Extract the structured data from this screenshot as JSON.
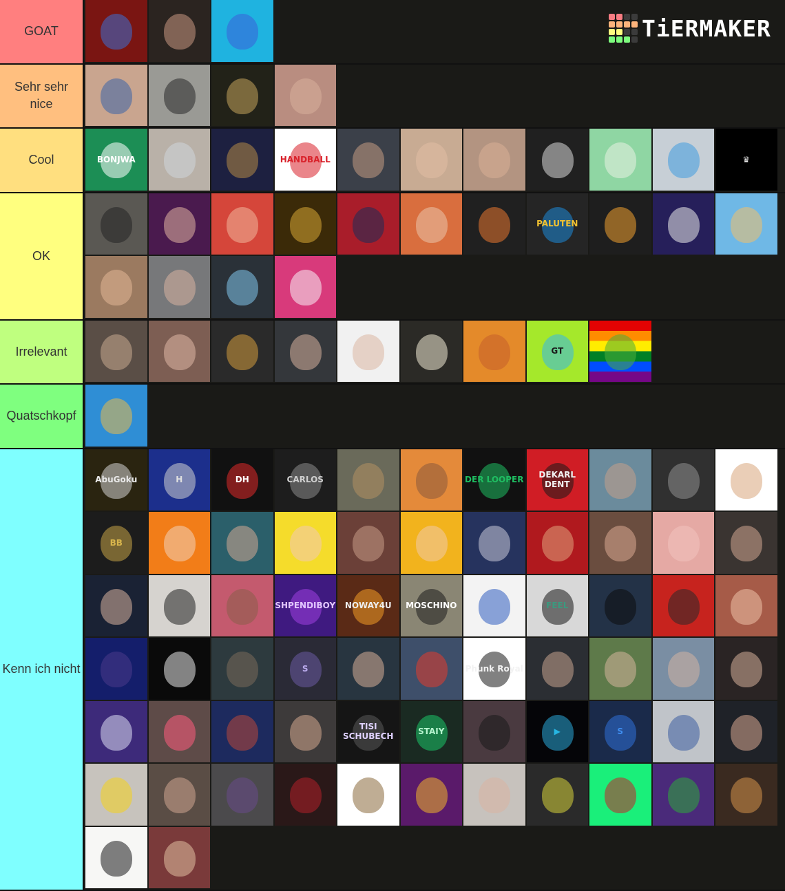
{
  "logo": {
    "text": "TiERMAKER",
    "grid_colors": [
      "#f87c82",
      "#f87c82",
      "#3b3b3b",
      "#3b3b3b",
      "#fcb37b",
      "#fcb37b",
      "#fcb37b",
      "#fcb37b",
      "#ffff7f",
      "#ffff7f",
      "#3b3b3b",
      "#3b3b3b",
      "#7dfd7e",
      "#7dfd7e",
      "#7dfd7e",
      "#3b3b3b"
    ]
  },
  "tiers": [
    {
      "label": "GOAT",
      "color": "#ff7f7f",
      "items": [
        {
          "name": "minecraft-red-skin-avatar",
          "color": "#7a1512",
          "face": "#3b6fd3",
          "text": ""
        },
        {
          "name": "woman-glasses-avatar",
          "color": "#2b2420",
          "face": "#c99882",
          "text": ""
        },
        {
          "name": "blue-dinosaur-logo",
          "color": "#1fb3e0",
          "face": "#3a5fd8",
          "text": ""
        }
      ]
    },
    {
      "label": "Sehr sehr nice",
      "color": "#ffbf7f",
      "items": [
        {
          "name": "man-blue-sunglasses-avatar",
          "color": "#c9a58f",
          "face": "#3a64a8",
          "text": ""
        },
        {
          "name": "vr-headset-avatar",
          "color": "#9a9a95",
          "face": "#2a2a2a",
          "text": ""
        },
        {
          "name": "cartoon-screaming-face-avatar",
          "color": "#222218",
          "face": "#c4a45c",
          "text": ""
        },
        {
          "name": "smiling-woman-avatar",
          "color": "#b98d80",
          "face": "#d8b09b",
          "text": ""
        }
      ]
    },
    {
      "label": "Cool",
      "color": "#ffdf7f",
      "items": [
        {
          "name": "bonjwa-logo",
          "color": "#1c8e55",
          "face": "#ffffff",
          "text": "BONJWA",
          "tcolor": "#ffffff"
        },
        {
          "name": "goggles-man-avatar",
          "color": "#b9b1a8",
          "face": "#cfd5da",
          "text": ""
        },
        {
          "name": "lion-avatar",
          "color": "#1d2040",
          "face": "#b58a46",
          "text": ""
        },
        {
          "name": "handball-logo",
          "color": "#ffffff",
          "face": "#d9212a",
          "text": "HANDBALL",
          "tcolor": "#d9212a"
        },
        {
          "name": "man-cap-avatar",
          "color": "#3b4049",
          "face": "#c59a82",
          "text": ""
        },
        {
          "name": "blonde-woman-avatar",
          "color": "#c8ab93",
          "face": "#e2bea4",
          "text": ""
        },
        {
          "name": "closeup-smile-avatar",
          "color": "#b39481",
          "face": "#d8ae95",
          "text": ""
        },
        {
          "name": "man-sunglasses-logo",
          "color": "#202020",
          "face": "#d8d8d8",
          "text": ""
        },
        {
          "name": "green-cat-cartoon",
          "color": "#8fd6a3",
          "face": "#eaf3e4",
          "text": ""
        },
        {
          "name": "blue-hair-man-avatar",
          "color": "#c7cfd6",
          "face": "#3f9de0",
          "text": ""
        },
        {
          "name": "crown-monogram-logo",
          "color": "#000000",
          "face": "#000000",
          "text": "♛",
          "tcolor": "#e8e8e8"
        }
      ]
    },
    {
      "label": "OK",
      "color": "#ffff7f",
      "items": [
        {
          "name": "bearded-man-hoodie-avatar",
          "color": "#5a5853",
          "face": "#242424",
          "text": ""
        },
        {
          "name": "woman-headset-avatar",
          "color": "#4a1a4e",
          "face": "#e0b5a0",
          "text": ""
        },
        {
          "name": "surprised-man-red-avatar",
          "color": "#d5463a",
          "face": "#f0b79a",
          "text": ""
        },
        {
          "name": "man-crown-gold-avatar",
          "color": "#3b2a08",
          "face": "#d7a634",
          "text": ""
        },
        {
          "name": "man-suit-red-avatar",
          "color": "#a91d2a",
          "face": "#1b2c57",
          "text": ""
        },
        {
          "name": "young-man-orange-avatar",
          "color": "#d96e3e",
          "face": "#e9c5aa",
          "text": ""
        },
        {
          "name": "orange-hexagon-logo",
          "color": "#202020",
          "face": "#e7772f",
          "text": ""
        },
        {
          "name": "team-paluten-logo",
          "color": "#252525",
          "face": "#1d8bd9",
          "text": "PALUTEN",
          "tcolor": "#f2c230"
        },
        {
          "name": "orange-fox-logo",
          "color": "#1e1e1e",
          "face": "#f0a02f",
          "text": ""
        },
        {
          "name": "astronaut-earth-logo",
          "color": "#261f5a",
          "face": "#e9e9e9",
          "text": ""
        },
        {
          "name": "minecraft-blonde-boy-avatar",
          "color": "#6fb8e6",
          "face": "#f0c069",
          "text": ""
        },
        {
          "name": "blonde-woman-selfie-avatar",
          "color": "#9b7a60",
          "face": "#e2b696",
          "text": ""
        },
        {
          "name": "man-earphones-avatar",
          "color": "#77787a",
          "face": "#d9b3a0",
          "text": ""
        },
        {
          "name": "blue-ball-cartoon",
          "color": "#2a3138",
          "face": "#7fc4eb",
          "text": ""
        },
        {
          "name": "white-cat-hat-cartoon",
          "color": "#d83a7b",
          "face": "#f8f1f5",
          "text": ""
        }
      ]
    },
    {
      "label": "Irrelevant",
      "color": "#bfff7f",
      "items": [
        {
          "name": "man-white-hoodie-avatar",
          "color": "#5a4e46",
          "face": "#c8a98f",
          "text": ""
        },
        {
          "name": "woman-choker-avatar",
          "color": "#7d5e53",
          "face": "#e0b8a5",
          "text": ""
        },
        {
          "name": "paw-crown-logo",
          "color": "#2a2a2a",
          "face": "#d29a3c",
          "text": ""
        },
        {
          "name": "esports-player-avatar",
          "color": "#34373b",
          "face": "#d6b09c",
          "text": ""
        },
        {
          "name": "young-man-white-shirt-avatar",
          "color": "#f1f1f1",
          "face": "#dab7a2",
          "text": ""
        },
        {
          "name": "cartoon-bearded-face",
          "color": "#2b2a26",
          "face": "#f1ead4",
          "text": ""
        },
        {
          "name": "ginger-beard-logo",
          "color": "#e48a2a",
          "face": "#c55f2a",
          "text": ""
        },
        {
          "name": "gt-logo",
          "color": "#a5e82b",
          "face": "#36b6ea",
          "text": "GT",
          "tcolor": "#1a1a1a"
        },
        {
          "name": "rainbow-controller-logo",
          "color": "#f2a20d",
          "face": "#4cad3b",
          "text": "",
          "rainbow": true
        }
      ]
    },
    {
      "label": "Quatschkopf",
      "color": "#7fff7f",
      "items": [
        {
          "name": "anime-glasses-avatar",
          "color": "#2f8ed5",
          "face": "#e9b949",
          "text": ""
        }
      ]
    },
    {
      "label": "Kenn ich nicht",
      "color": "#7fffff",
      "items": [
        {
          "name": "abugoku-logo",
          "color": "#2a2410",
          "face": "#d1d1d1",
          "text": "AbuGoku",
          "tcolor": "#e9e9e9"
        },
        {
          "name": "harmii-logo",
          "color": "#1c2f8c",
          "face": "#d0d0d0",
          "text": "H",
          "tcolor": "#e0e0e0"
        },
        {
          "name": "dh-flame-logo",
          "color": "#111111",
          "face": "#e02a2a",
          "text": "DH",
          "tcolor": "#ffffff"
        },
        {
          "name": "carlos-emblem-logo",
          "color": "#1d1d1d",
          "face": "#8a8a8a",
          "text": "CARLOS",
          "tcolor": "#cfcfcf"
        },
        {
          "name": "gta-character-avatar",
          "color": "#6a6a5a",
          "face": "#b38f63",
          "text": ""
        },
        {
          "name": "boxer-cartoon-avatar",
          "color": "#e48a3a",
          "face": "#8a5a3c",
          "text": ""
        },
        {
          "name": "der-looper-logo",
          "color": "#111111",
          "face": "#1fbe62",
          "text": "DER LOOPER",
          "tcolor": "#1fbe62"
        },
        {
          "name": "dekarldent-logo",
          "color": "#d01d25",
          "face": "#1a1a1a",
          "text": "DEKARL DENT",
          "tcolor": "#f1f1f1"
        },
        {
          "name": "man-hood-outdoor-avatar",
          "color": "#6b8b9c",
          "face": "#c4a08a",
          "text": ""
        },
        {
          "name": "man-mic-dark-avatar",
          "color": "#303030",
          "face": "#909090",
          "text": ""
        },
        {
          "name": "memoji-avatar",
          "color": "#ffffff",
          "face": "#d9a57b",
          "text": ""
        },
        {
          "name": "bb-gold-logo",
          "color": "#1c1c1c",
          "face": "#c6a447",
          "text": "BB",
          "tcolor": "#d8b54c"
        },
        {
          "name": "cartoon-beard-glasses-avatar",
          "color": "#f27d18",
          "face": "#f0d2b9",
          "text": ""
        },
        {
          "name": "man-blue-wall-avatar",
          "color": "#2b5f6a",
          "face": "#d3a892",
          "text": ""
        },
        {
          "name": "anime-blonde-avatar",
          "color": "#f5dc2b",
          "face": "#f0c8b4",
          "text": ""
        },
        {
          "name": "red-hair-kid-avatar",
          "color": "#6b4038",
          "face": "#c79b86",
          "text": ""
        },
        {
          "name": "cartoon-man-yellow-avatar",
          "color": "#f2b31d",
          "face": "#f0c8a7",
          "text": ""
        },
        {
          "name": "man-pointing-avatar",
          "color": "#26335e",
          "face": "#c9c9d8",
          "text": ""
        },
        {
          "name": "bald-glasses-cartoon",
          "color": "#b0191e",
          "face": "#e0a37c",
          "text": ""
        },
        {
          "name": "smiling-man-closeup-avatar",
          "color": "#6a4d3f",
          "face": "#d8a992",
          "text": ""
        },
        {
          "name": "pink-blurry-face-avatar",
          "color": "#e5a9a4",
          "face": "#f2c3bd",
          "text": ""
        },
        {
          "name": "man-dark-hair-avatar",
          "color": "#3a3431",
          "face": "#d0a690",
          "text": ""
        },
        {
          "name": "man-black-hoodie-red-avatar",
          "color": "#1a2234",
          "face": "#d8b29f",
          "text": ""
        },
        {
          "name": "woman-fur-hat-avatar",
          "color": "#d6d3cf",
          "face": "#222222",
          "text": ""
        },
        {
          "name": "man-neon-avatar",
          "color": "#c45a6e",
          "face": "#8a5e4a",
          "text": ""
        },
        {
          "name": "shpendiboy-logo",
          "color": "#3f1a80",
          "face": "#a03fe0",
          "text": "SHPENDIBOY",
          "tcolor": "#e2c7ff"
        },
        {
          "name": "noway4u-logo",
          "color": "#5a2a16",
          "face": "#f39a26",
          "text": "NOWAY4U",
          "tcolor": "#ededed"
        },
        {
          "name": "man-moschino-avatar",
          "color": "#8a8674",
          "face": "#1d1d1d",
          "text": "MOSCHINO",
          "tcolor": "#ffffff"
        },
        {
          "name": "football-player-blue-avatar",
          "color": "#f3f3f3",
          "face": "#2f5cbf",
          "text": ""
        },
        {
          "name": "feel-fifa-gaming-logo",
          "color": "#d8d8d8",
          "face": "#171717",
          "text": "FEEL",
          "tcolor": "#3a9a7f"
        },
        {
          "name": "silhouette-starry-sky",
          "color": "#233247",
          "face": "#0d0d0d",
          "text": ""
        },
        {
          "name": "man-red-circle-avatar",
          "color": "#c7231e",
          "face": "#2a2a2a",
          "text": ""
        },
        {
          "name": "redhead-woman-avatar",
          "color": "#a65b48",
          "face": "#ecc1a7",
          "text": ""
        },
        {
          "name": "man-versace-blue-avatar",
          "color": "#141e6b",
          "face": "#4a3b8a",
          "text": ""
        },
        {
          "name": "beanie-man-sketch-logo",
          "color": "#0a0a0a",
          "face": "#e8e8e8",
          "text": ""
        },
        {
          "name": "muscular-man-avatar",
          "color": "#2d3a3e",
          "face": "#7a6a5a",
          "text": ""
        },
        {
          "name": "purple-s-logo",
          "color": "#2a2a36",
          "face": "#6a5aa3",
          "text": "S",
          "tcolor": "#b8a8ea"
        },
        {
          "name": "man-shush-avatar",
          "color": "#283540",
          "face": "#d6ad96",
          "text": ""
        },
        {
          "name": "red-bean-cartoon",
          "color": "#3e4f6a",
          "face": "#e13c2c",
          "text": ""
        },
        {
          "name": "phunk-royal-logo",
          "color": "#ffffff",
          "face": "#1a1a1a",
          "text": "Phunk Royal",
          "tcolor": "#f2f2f2"
        },
        {
          "name": "man-studio-avatar",
          "color": "#2b2e33",
          "face": "#c7a48e",
          "text": ""
        },
        {
          "name": "man-blonde-outdoor-avatar",
          "color": "#5e7a4a",
          "face": "#d6b49c",
          "text": ""
        },
        {
          "name": "man-robe-avatar",
          "color": "#7a8ea3",
          "face": "#d2b3a2",
          "text": ""
        },
        {
          "name": "young-man-red-avatar",
          "color": "#2a2424",
          "face": "#d3ae99",
          "text": ""
        },
        {
          "name": "anime-white-hair-avatar",
          "color": "#3d2a7a",
          "face": "#dcdcf2",
          "text": ""
        },
        {
          "name": "man-pink-shirt-avatar",
          "color": "#5e4b48",
          "face": "#ff5c7e",
          "text": ""
        },
        {
          "name": "woman-red-blue-avatar",
          "color": "#1d2a5e",
          "face": "#b8473a",
          "text": ""
        },
        {
          "name": "boy-thumbs-up-avatar",
          "color": "#3d3a3a",
          "face": "#d4a88e",
          "text": ""
        },
        {
          "name": "tisi-schubech-logo",
          "color": "#151515",
          "face": "#5a5a5a",
          "text": "TISI SCHUBECH",
          "tcolor": "#e0d2ff"
        },
        {
          "name": "staiy-logo",
          "color": "#1a2a22",
          "face": "#1bc467",
          "text": "STAIY",
          "tcolor": "#b6f5cf"
        },
        {
          "name": "silhouette-sunset",
          "color": "#4a3a40",
          "face": "#1a1a1a",
          "text": ""
        },
        {
          "name": "blue-play-logo",
          "color": "#050508",
          "face": "#2aa8d8",
          "text": "▶",
          "tcolor": "#27b7e4"
        },
        {
          "name": "blue-bird-s-logo",
          "color": "#1a2a4a",
          "face": "#2f70d8",
          "text": "S",
          "tcolor": "#3f8ef0"
        },
        {
          "name": "man-camo-hoodie-avatar",
          "color": "#c0c4c9",
          "face": "#3d5fa0",
          "text": ""
        },
        {
          "name": "bearded-laughing-man-avatar",
          "color": "#1f2228",
          "face": "#d7a890",
          "text": ""
        },
        {
          "name": "man-bvb-jersey-avatar",
          "color": "#c7c3bd",
          "face": "#f4d21b",
          "text": ""
        },
        {
          "name": "man-closeup-face-avatar",
          "color": "#5a4d45",
          "face": "#cfa68f",
          "text": ""
        },
        {
          "name": "man-squatting-garage-avatar",
          "color": "#4b4a4c",
          "face": "#6a4a8a",
          "text": ""
        },
        {
          "name": "masked-man-cartoon",
          "color": "#2a1818",
          "face": "#b0202a",
          "text": ""
        },
        {
          "name": "owl-cartoon",
          "color": "#ffffff",
          "face": "#8a6a3c",
          "text": ""
        },
        {
          "name": "colorful-nutcracker-avatar",
          "color": "#5a1a6a",
          "face": "#f0b42a",
          "text": ""
        },
        {
          "name": "man-blonde-closeup-avatar",
          "color": "#c7c2bd",
          "face": "#d8b4a2",
          "text": ""
        },
        {
          "name": "man-camo-jacket-avatar",
          "color": "#2a2a2a",
          "face": "#d6d23a",
          "text": ""
        },
        {
          "name": "man-cap-glasses-cartoon",
          "color": "#1aef7a",
          "face": "#c7202a",
          "text": ""
        },
        {
          "name": "tree-cartoon-logo",
          "color": "#4a2a7a",
          "face": "#2eaa3a",
          "text": ""
        },
        {
          "name": "dragon-man-avatar",
          "color": "#3a2a20",
          "face": "#d3924a",
          "text": ""
        },
        {
          "name": "ghost-headset-sketch",
          "color": "#f7f7f5",
          "face": "#1a1a1a",
          "text": ""
        },
        {
          "name": "blonde-woman-gaming-avatar",
          "color": "#7a3a3a",
          "face": "#e0bfa0",
          "text": ""
        }
      ]
    }
  ]
}
